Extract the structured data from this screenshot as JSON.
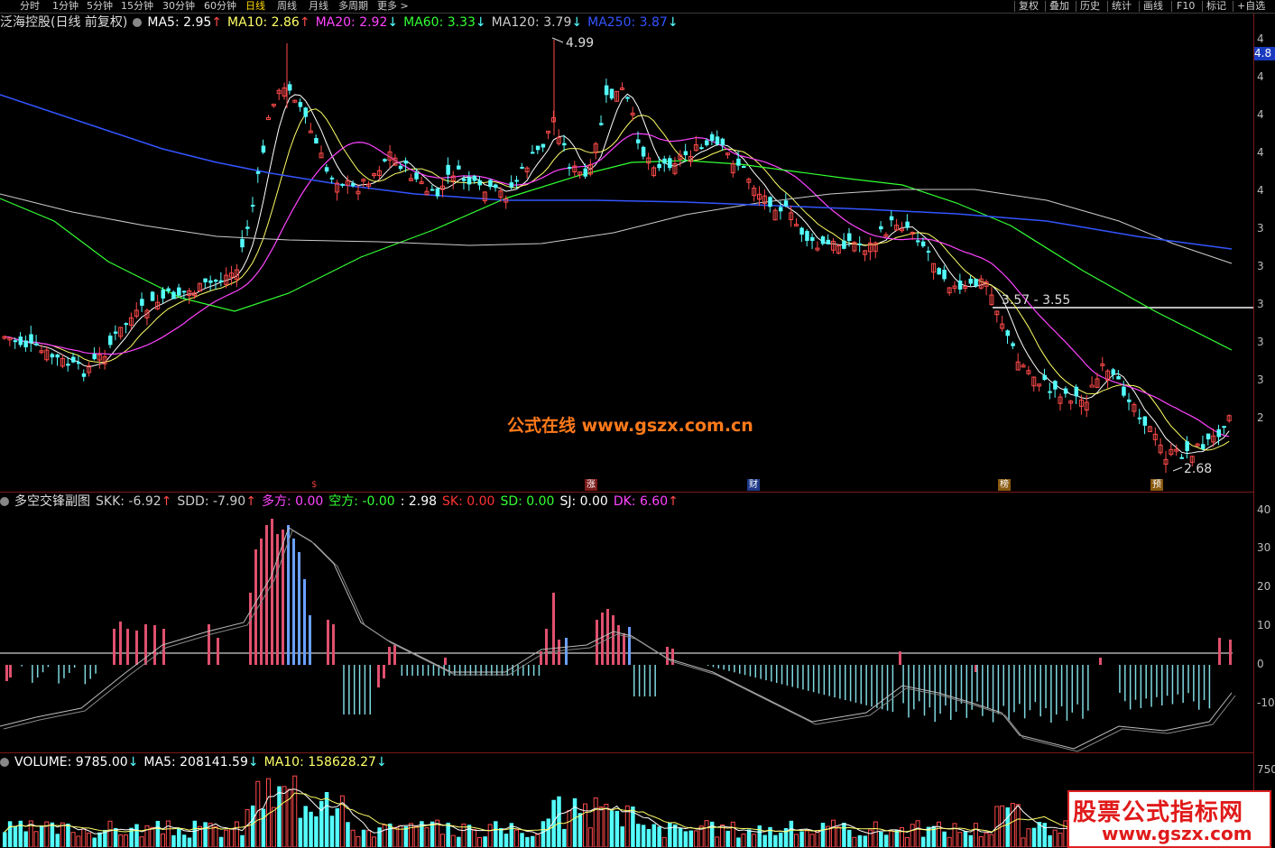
{
  "periods": [
    "分时",
    "1分钟",
    "5分钟",
    "15分钟",
    "30分钟",
    "60分钟",
    "日线",
    "周线",
    "月线",
    "多周期",
    "更多 >"
  ],
  "active_period": "日线",
  "tools": [
    "复权",
    "叠加",
    "历史",
    "统计",
    "画线",
    "F10",
    "标记",
    "+自选"
  ],
  "main": {
    "stock": "泛海控股(日线 前复权)",
    "ma": [
      {
        "label": "MA5: 2.95",
        "arrow": "↑",
        "color": "#ffffff"
      },
      {
        "label": "MA10: 2.86",
        "arrow": "↑",
        "color": "#ffff66"
      },
      {
        "label": "MA20: 2.92",
        "arrow": "↓",
        "color": "#ff44ff"
      },
      {
        "label": "MA60: 3.33",
        "arrow": "↓",
        "color": "#33ff33"
      },
      {
        "label": "MA120: 3.79",
        "arrow": "↓",
        "color": "#cccccc"
      },
      {
        "label": "MA250: 3.87",
        "arrow": "↓",
        "color": "#3355ff"
      }
    ],
    "high_label": "4.99",
    "low_label": "2.68",
    "range_label": "3.57 - 3.55",
    "price_tag": "4.8",
    "y_ticks": [
      "4",
      "4",
      "4",
      "4",
      "4",
      "3",
      "3",
      "3",
      "3",
      "3",
      "2"
    ],
    "events": [
      {
        "text": "$",
        "color": "#e03a3a"
      },
      {
        "text": "涨",
        "color": "#e03a3a"
      },
      {
        "text": "财",
        "color": "#3a6adf"
      },
      {
        "text": "榜",
        "color": "#d49a30"
      },
      {
        "text": "预",
        "color": "#d49a30"
      }
    ]
  },
  "watermark": "公式在线  www.gszx.com.cn",
  "sub": {
    "name": "多空交锋副图",
    "values": [
      {
        "label": "SKK: -6.92",
        "arrow": "↑",
        "color": "#cccccc"
      },
      {
        "label": "SDD: -7.90",
        "arrow": "↑",
        "color": "#cccccc"
      },
      {
        "label": "多方: 0.00",
        "color": "#ff44ff"
      },
      {
        "label": "空方: -0.00",
        "color": "#33ff33"
      },
      {
        "label": ": 2.98",
        "color": "#ffffff"
      },
      {
        "label": "SK: 0.00",
        "color": "#ff3333"
      },
      {
        "label": "SD: 0.00",
        "color": "#33ff33"
      },
      {
        "label": "SJ: 0.00",
        "color": "#ffffff"
      },
      {
        "label": "DK: 6.60",
        "arrow": "↑",
        "color": "#ff44ff"
      }
    ],
    "y_ticks": [
      "40",
      "30",
      "20",
      "10",
      "0",
      "-10"
    ]
  },
  "volume": {
    "values": [
      {
        "label": "VOLUME: 9785.00",
        "arrow": "↓",
        "color": "#ffffff"
      },
      {
        "label": "MA5: 208141.59",
        "arrow": "↓",
        "color": "#ffffff"
      },
      {
        "label": "MA10: 158628.27",
        "arrow": "↓",
        "color": "#ffff66"
      }
    ],
    "y_tick": "750"
  },
  "badge": {
    "line1": "股票公式指标网",
    "line2": "www.gszx.com"
  },
  "colors": {
    "up": "#ff4a4a",
    "down": "#54ffff",
    "grid": "#7a1a1a"
  }
}
